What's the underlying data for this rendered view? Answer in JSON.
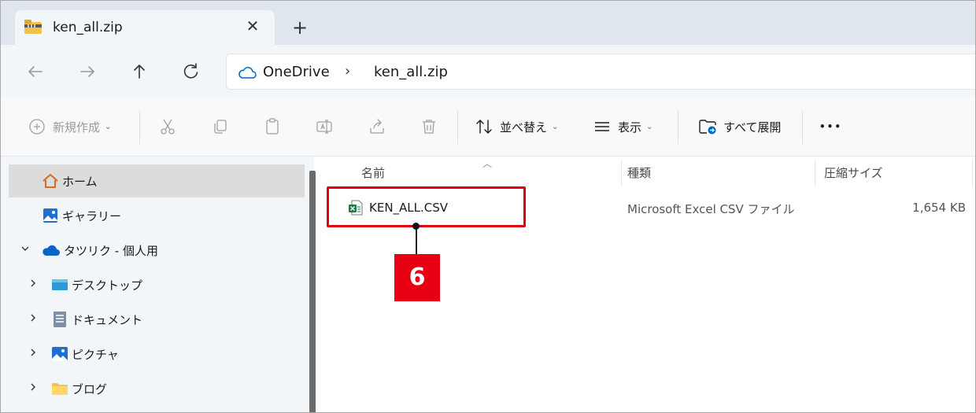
{
  "tab": {
    "title": "ken_all.zip",
    "close_glyph": "✕",
    "new_glyph": "+"
  },
  "address": {
    "root": "OneDrive",
    "separator": "›",
    "current": "ken_all.zip"
  },
  "toolbar": {
    "new_label": "新規作成",
    "sort_label": "並べ替え",
    "view_label": "表示",
    "extract_label": "すべて展開",
    "more_glyph": "•••"
  },
  "sidebar": {
    "items": [
      {
        "label": "ホーム",
        "icon": "home-icon"
      },
      {
        "label": "ギャラリー",
        "icon": "gallery-icon"
      },
      {
        "label": "タツリク - 個人用",
        "icon": "onedrive-cloud-icon"
      },
      {
        "label": "デスクトップ",
        "icon": "desktop-icon"
      },
      {
        "label": "ドキュメント",
        "icon": "documents-icon"
      },
      {
        "label": "ピクチャ",
        "icon": "pictures-icon"
      },
      {
        "label": "ブログ",
        "icon": "folder-icon"
      }
    ]
  },
  "columns": {
    "name": "名前",
    "type": "種類",
    "size": "圧縮サイズ"
  },
  "files": [
    {
      "name": "KEN_ALL.CSV",
      "type": "Microsoft Excel CSV ファイル",
      "size": "1,654 KB",
      "icon": "excel-csv-icon"
    }
  ],
  "callout": {
    "number": "6"
  },
  "colors": {
    "highlight": "#e0000f",
    "badge": "#e60012",
    "accent": "#0067c0"
  }
}
